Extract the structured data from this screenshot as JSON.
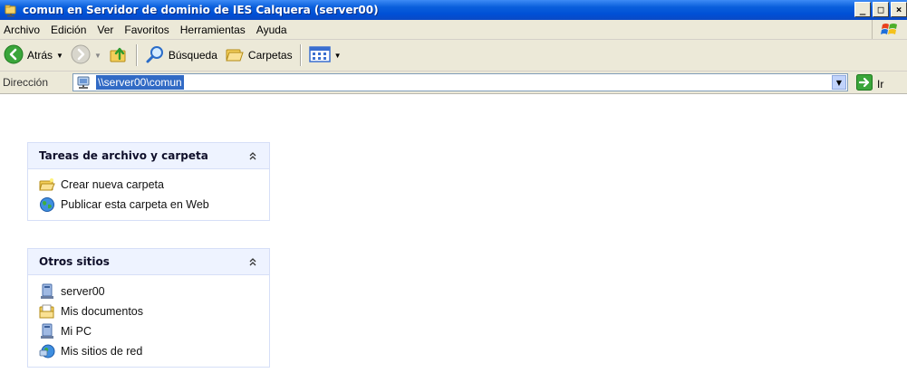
{
  "window": {
    "title": "comun en Servidor de dominio de IES Calquera (server00)",
    "app_icon": "folder-network-icon",
    "caption_buttons": [
      "_",
      "□",
      "×"
    ]
  },
  "menubar": {
    "items": [
      "Archivo",
      "Edición",
      "Ver",
      "Favoritos",
      "Herramientas",
      "Ayuda"
    ]
  },
  "toolbar": {
    "back_label": "Atrás",
    "search_label": "Búsqueda",
    "folders_label": "Carpetas"
  },
  "address": {
    "label": "Dirección",
    "value": "\\\\server00\\comun",
    "go_label": "Ir"
  },
  "panels": {
    "file_tasks": {
      "title": "Tareas de archivo y carpeta",
      "items": [
        {
          "label": "Crear nueva carpeta",
          "icon": "new-folder-icon"
        },
        {
          "label": "Publicar esta carpeta en Web",
          "icon": "publish-web-icon"
        }
      ]
    },
    "other_places": {
      "title": "Otros sitios",
      "items": [
        {
          "label": "server00",
          "icon": "computer-icon"
        },
        {
          "label": "Mis documentos",
          "icon": "my-documents-icon"
        },
        {
          "label": "Mi PC",
          "icon": "my-computer-icon"
        },
        {
          "label": "Mis sitios de red",
          "icon": "network-places-icon"
        }
      ]
    }
  },
  "colors": {
    "titlebar": "#0a5fdc",
    "chrome": "#ece9d8",
    "panel_header": "#eef3ff",
    "selection": "#316ac5"
  }
}
